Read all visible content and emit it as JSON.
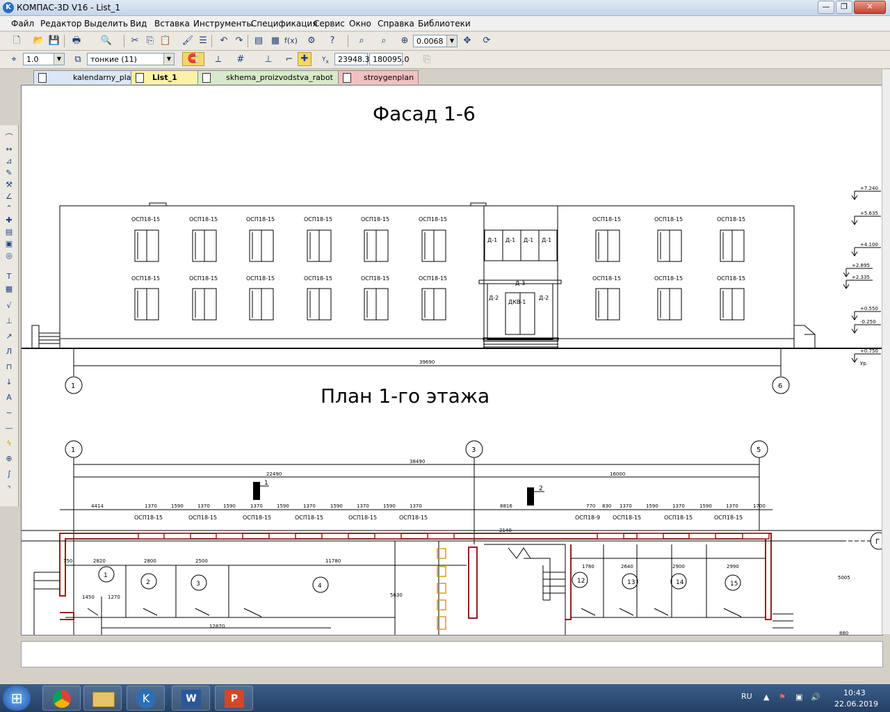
{
  "window": {
    "title": "КОМПАС-3D V16  - List_1",
    "minimize": "—",
    "maximize": "❐",
    "close": "✕"
  },
  "menu": [
    "Файл",
    "Редактор",
    "Выделить",
    "Вид",
    "Вставка",
    "Инструменты",
    "Спецификация",
    "Сервис",
    "Окно",
    "Справка",
    "Библиотеки"
  ],
  "toolbar": {
    "zoom_value": "0.0068"
  },
  "props": {
    "step": "1.0",
    "line_style": "тонкие (11)",
    "coord_x": "23948.3",
    "coord_y": "180095.0"
  },
  "tabs": [
    {
      "label": "kalendarny_plan"
    },
    {
      "label": "List_1",
      "close": "×"
    },
    {
      "label": "skhema_proizvodstva_rabot"
    },
    {
      "label": "stroygenplan"
    }
  ],
  "drawing": {
    "facade_title": "Фасад 1-6",
    "plan_title": "План 1-го этажа",
    "window_mark": "ОСП18-15",
    "door_mark": "Д-1",
    "door2_mark": "Д-2",
    "door3_mark": "Д-3",
    "entrance_mark": "ДКВ-1",
    "facade_width": "39690",
    "axis_1": "1",
    "axis_3": "3",
    "axis_5": "5",
    "axis_6": "6",
    "axis_g": "Г",
    "levels": [
      "+7.240",
      "+5.635",
      "+4.100",
      "+2.895",
      "+2.335",
      "+0.550",
      "-0.250",
      "+0.750"
    ],
    "level_note": "Ур.",
    "plan_total": "38490",
    "plan_dim_a": "22490",
    "plan_dim_b": "16000",
    "section_1": "1",
    "section_2": "2",
    "plan_window_mark": "ОСП18-9",
    "segment_dims": [
      "4414",
      "1370",
      "1590",
      "1370",
      "1590",
      "1370",
      "1590",
      "1370",
      "1590",
      "1370",
      "1590",
      "1370"
    ],
    "right_dims": [
      "8816",
      "770",
      "830",
      "1370",
      "1590",
      "1370",
      "1590",
      "1370",
      "1700"
    ],
    "room_dims": [
      "2820",
      "2800",
      "2500",
      "11780",
      "1780",
      "2640",
      "2900",
      "2990"
    ],
    "rooms": [
      "1",
      "2",
      "3",
      "4",
      "12",
      "13",
      "14",
      "15"
    ],
    "misc_dims": [
      "1450",
      "1270",
      "12870",
      "750",
      "5630",
      "5005",
      "880",
      "2140"
    ]
  },
  "tray": {
    "lang": "RU",
    "time": "10:43",
    "date": "22.06.2019"
  },
  "taskbar": {
    "start": "⊞"
  }
}
